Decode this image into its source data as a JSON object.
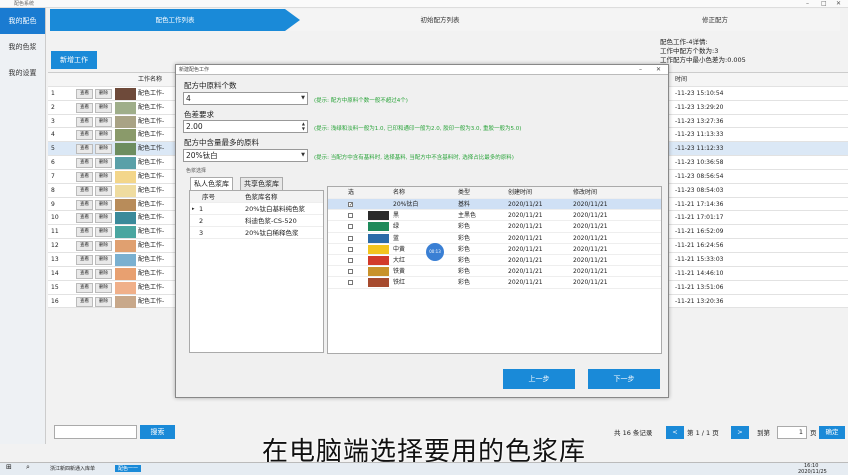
{
  "window": {
    "title": "配色系统",
    "min": "–",
    "max": "□",
    "close": "✕"
  },
  "sidebar": {
    "items": [
      {
        "label": "我的配色",
        "active": true
      },
      {
        "label": "我的色浆",
        "active": false
      },
      {
        "label": "我的设置",
        "active": false
      }
    ]
  },
  "steps": [
    "配色工作列表",
    "初始配方列表",
    "修正配方"
  ],
  "info": {
    "line1": "配色工作-4详情:",
    "line2": "工作中配方个数为:3",
    "line3": "工作配方中最小色差为:0.005"
  },
  "toolbar": {
    "new_work": "新增工作"
  },
  "bg_table": {
    "header_name": "工作名称",
    "header_time": "时间",
    "btn_edit": "查看",
    "btn_delete": "删除",
    "rows": [
      {
        "no": "1",
        "name": "配色工作-",
        "time": "-11-23 15:10:54",
        "color": "#6e4a3a"
      },
      {
        "no": "2",
        "name": "配色工作-",
        "time": "-11-23 13:29:20",
        "color": "#9fae8a"
      },
      {
        "no": "3",
        "name": "配色工作-",
        "time": "-11-23 13:27:36",
        "color": "#a9a385"
      },
      {
        "no": "4",
        "name": "配色工作-",
        "time": "-11-23 11:13:33",
        "color": "#8a9a6a"
      },
      {
        "no": "5",
        "name": "配色工作-",
        "time": "-11-23 11:12:33",
        "color": "#6d8d5f",
        "selected": true
      },
      {
        "no": "6",
        "name": "配色工作-",
        "time": "-11-23 10:36:58",
        "color": "#5aa0a8"
      },
      {
        "no": "7",
        "name": "配色工作-",
        "time": "-11-23 08:56:54",
        "color": "#f3d68a"
      },
      {
        "no": "8",
        "name": "配色工作-",
        "time": "-11-23 08:54:03",
        "color": "#efdca0"
      },
      {
        "no": "9",
        "name": "配色工作-",
        "time": "-11-21 17:14:36",
        "color": "#b88c5a"
      },
      {
        "no": "10",
        "name": "配色工作-",
        "time": "-11-21 17:01:17",
        "color": "#3a8a9a"
      },
      {
        "no": "11",
        "name": "配色工作-",
        "time": "-11-21 16:52:09",
        "color": "#4aa6a0"
      },
      {
        "no": "12",
        "name": "配色工作-",
        "time": "-11-21 16:24:56",
        "color": "#e0a070"
      },
      {
        "no": "13",
        "name": "配色工作-",
        "time": "-11-21 15:33:03",
        "color": "#7ab0d0"
      },
      {
        "no": "14",
        "name": "配色工作-",
        "time": "-11-21 14:46:10",
        "color": "#e8a070"
      },
      {
        "no": "15",
        "name": "配色工作-",
        "time": "-11-21 13:51:06",
        "color": "#f0b08a"
      },
      {
        "no": "16",
        "name": "配色工作-",
        "time": "-11-21 13:20:36",
        "color": "#c8a88a"
      }
    ]
  },
  "bottom": {
    "search_btn": "搜索",
    "total": "共 16 条记录",
    "prev": "<",
    "page": "第 1 / 1 页",
    "next": ">",
    "goto": "到第",
    "goto_value": "1",
    "page_unit": "页",
    "confirm": "确定"
  },
  "dialog": {
    "title": "新建配色工作",
    "f1_label": "配方中原料个数",
    "f1_value": "4",
    "f1_tip": "(提示: 配方中原料个数一般不超过4个)",
    "f2_label": "色差要求",
    "f2_value": "2.00",
    "f2_tip": "(提示: 浅绿和淡料一般为1.0, 已印和通印一般为2.0, 胶印一般为3.0, 重胶一般为5.0)",
    "f3_label": "配方中含量最多的原料",
    "f3_value": "20%钛白",
    "f3_tip": "(提示: 当配方中含有基料时, 选择基料, 当配方中不含基料时, 选择占比最多的原料)",
    "section": "色浆选择",
    "tabs": [
      "私人色浆库",
      "共享色浆库"
    ],
    "left_grid": {
      "headers": [
        "序号",
        "色浆库名称"
      ],
      "rows": [
        {
          "no": "1",
          "name": "20%钛白基料纯色浆"
        },
        {
          "no": "2",
          "name": "科迪色浆-CS-520"
        },
        {
          "no": "3",
          "name": "20%钛白稀释色浆"
        }
      ]
    },
    "right_grid": {
      "headers": [
        "选",
        "名称",
        "类型",
        "创建时间",
        "修改时间"
      ],
      "rows": [
        {
          "checked": true,
          "name": "20%钛白",
          "type": "基料",
          "created": "2020/11/21",
          "modified": "2020/11/21",
          "color": "",
          "selected": true
        },
        {
          "checked": false,
          "name": "黑",
          "type": "主黑色",
          "created": "2020/11/21",
          "modified": "2020/11/21",
          "color": "#2b2b2b"
        },
        {
          "checked": false,
          "name": "绿",
          "type": "彩色",
          "created": "2020/11/21",
          "modified": "2020/11/21",
          "color": "#1e8a5a"
        },
        {
          "checked": false,
          "name": "蓝",
          "type": "彩色",
          "created": "2020/11/21",
          "modified": "2020/11/21",
          "color": "#2a6aa8"
        },
        {
          "checked": false,
          "name": "中黄",
          "type": "彩色",
          "created": "2020/11/21",
          "modified": "2020/11/21",
          "color": "#f2c41e"
        },
        {
          "checked": false,
          "name": "大红",
          "type": "彩色",
          "created": "2020/11/21",
          "modified": "2020/11/21",
          "color": "#d23a2a"
        },
        {
          "checked": false,
          "name": "铁黄",
          "type": "彩色",
          "created": "2020/11/21",
          "modified": "2020/11/21",
          "color": "#c8922a"
        },
        {
          "checked": false,
          "name": "铁红",
          "type": "彩色",
          "created": "2020/11/21",
          "modified": "2020/11/21",
          "color": "#a64a2e"
        }
      ]
    },
    "prev_btn": "上一步",
    "next_btn": "下一步"
  },
  "cursor_label": "00:13",
  "subtitle": "在电脑端选择要用的色浆库",
  "taskbar": {
    "start": "⊞",
    "search": "⌕",
    "task1": "浙江新四新通入库单",
    "task2": "配色一一",
    "time": "16:10",
    "date": "2020/11/25"
  }
}
